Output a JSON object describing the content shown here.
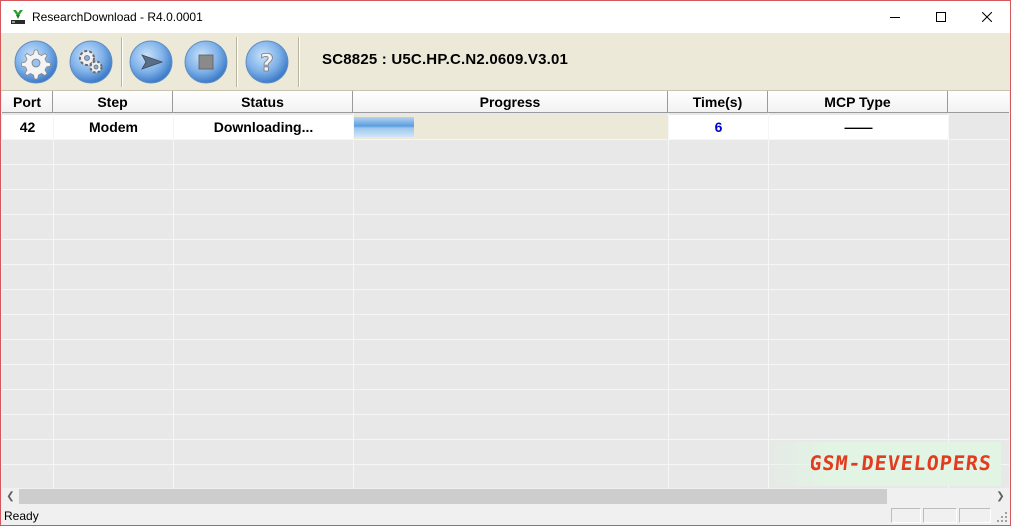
{
  "window": {
    "title": "ResearchDownload - R4.0.0001",
    "border_color": "#d3575b",
    "controls": [
      "minimize-icon",
      "maximize-icon",
      "close-icon"
    ]
  },
  "toolbar": {
    "buttons": [
      {
        "name": "load-packet-button",
        "icon": "gear-icon"
      },
      {
        "name": "settings-button",
        "icon": "gears-icon"
      },
      {
        "name": "start-download-button",
        "icon": "play-arrow-icon"
      },
      {
        "name": "stop-download-button",
        "icon": "stop-square-icon"
      },
      {
        "name": "help-button",
        "icon": "question-mark-icon"
      }
    ],
    "version": "SC8825 : U5C.HP.C.N2.0609.V3.01"
  },
  "table": {
    "columns": [
      "Port",
      "Step",
      "Status",
      "Progress",
      "Time(s)",
      "MCP Type"
    ],
    "rows": [
      {
        "port": "42",
        "step": "Modem",
        "status": "Downloading...",
        "progress": 0.19,
        "time": "6",
        "mcp_type": "——"
      }
    ],
    "time_color": "#0000c8"
  },
  "watermark": {
    "logo": "GSM-DEVELOPERS"
  },
  "statusbar": {
    "text": "Ready"
  }
}
